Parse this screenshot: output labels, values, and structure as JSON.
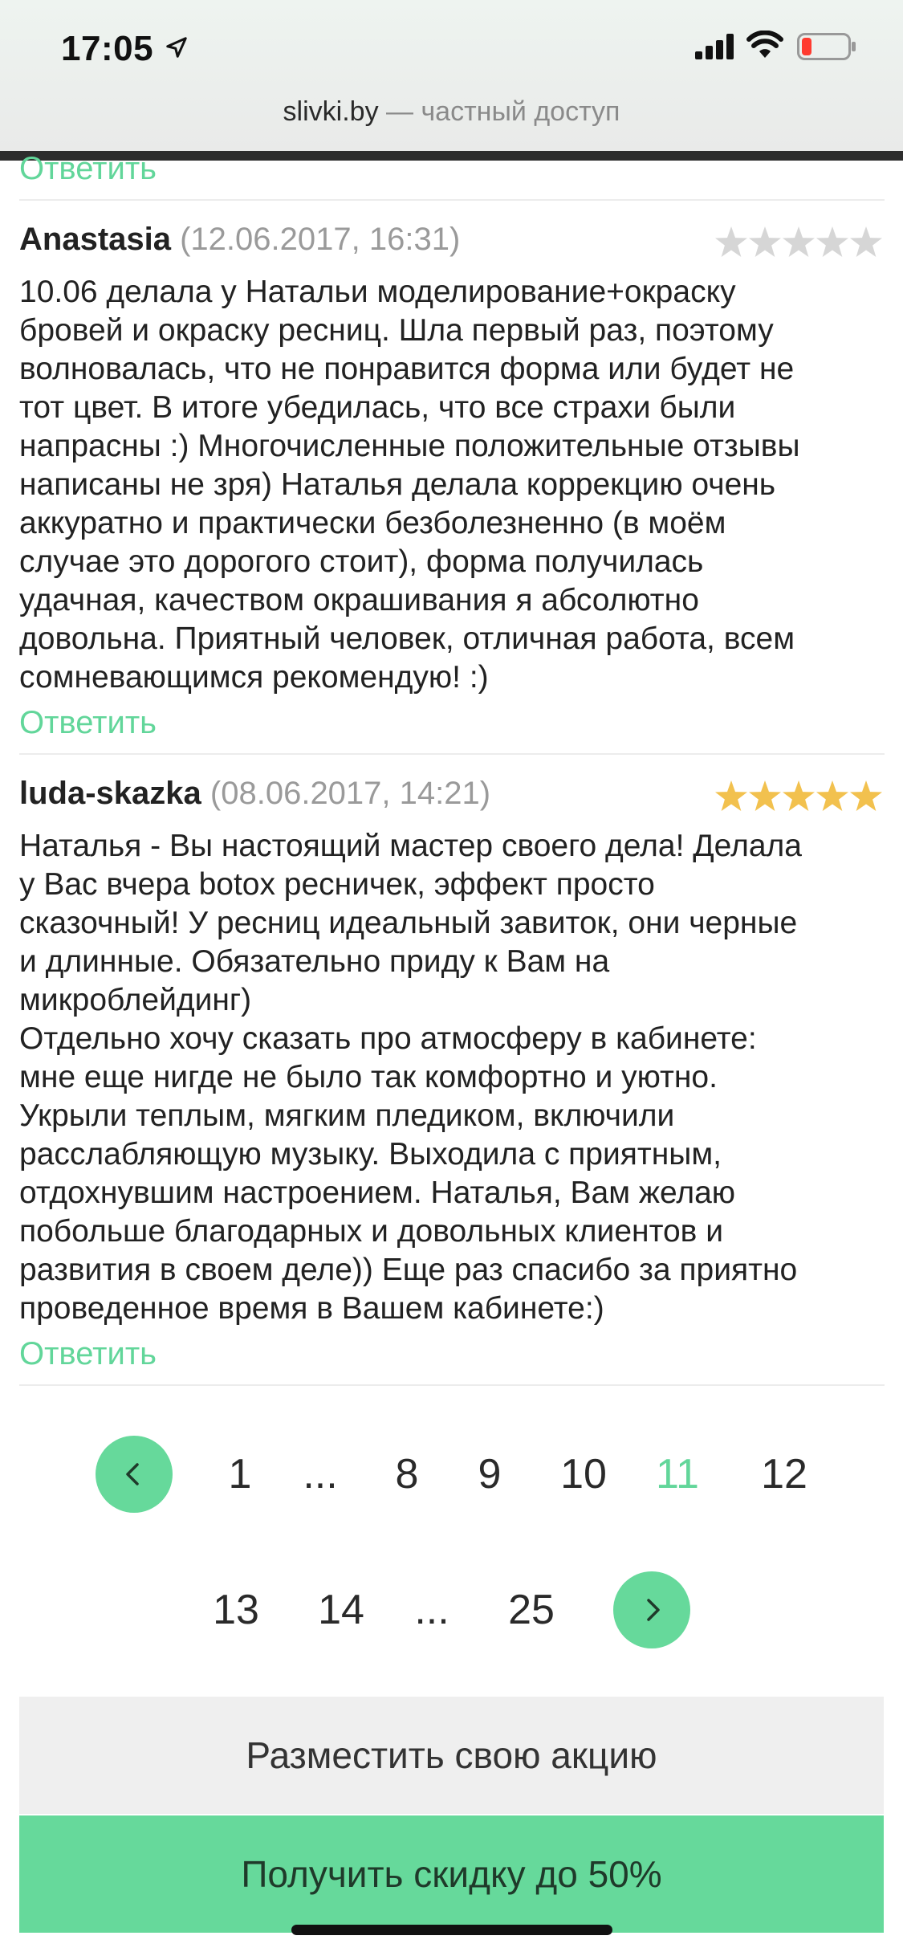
{
  "status_bar": {
    "time": "17:05"
  },
  "browser": {
    "domain": "slivki.by",
    "suffix": " — частный доступ"
  },
  "reviews": [
    {
      "author": "Anastasia",
      "date": "(12.06.2017, 16:31)",
      "rating": 0,
      "text": "10.06 делала у Натальи моделирование+окраску\nбровей и окраску ресниц. Шла первый раз, поэтому\nволновалась, что не понравится форма или будет не\nтот цвет. В итоге убедилась, что все страхи были\nнапрасны :) Многочисленные положительные отзывы\nнаписаны не зря) Наталья делала коррекцию очень\nаккуратно и практически безболезненно (в моём\nслучае это дорогого стоит), форма получилась\nудачная, качеством окрашивания я абсолютно\nдовольна. Приятный человек, отличная работа, всем\nсомневающимся рекомендую! :)"
    },
    {
      "author": "luda-skazka",
      "date": "(08.06.2017, 14:21)",
      "rating": 5,
      "text": "Наталья - Вы настоящий мастер своего дела! Делала\nу Вас вчера botox ресничек, эффект просто\nсказочный! У ресниц идеальный завиток, они черные\nи длинные. Обязательно приду к Вам на\nмикроблейдинг)\nОтдельно хочу сказать про атмосферу в кабинете:\nмне еще нигде не было так комфортно и уютно.\nУкрыли теплым, мягким пледиком, включили\nрасслабляющую музыку. Выходила с приятным,\nотдохнувшим настроением. Наталья, Вам желаю\nпобольше благодарных и довольных клиентов и\nразвития в своем деле)) Еще раз спасибо за приятно\nпроведенное время в Вашем кабинете:)"
    }
  ],
  "reply_label": "Ответить",
  "pagination": {
    "row1": [
      "1",
      "...",
      "8",
      "9",
      "10",
      "11",
      "12"
    ],
    "row2": [
      "13",
      "14",
      "...",
      "25"
    ],
    "current": "11"
  },
  "actions": {
    "secondary": "Разместить свою акцию",
    "primary": "Получить скидку до 50%"
  },
  "colors": {
    "accent": "#66d99b",
    "link": "#62d69a",
    "star_active": "#f2c14e",
    "star_inactive": "#d6d6d6"
  }
}
